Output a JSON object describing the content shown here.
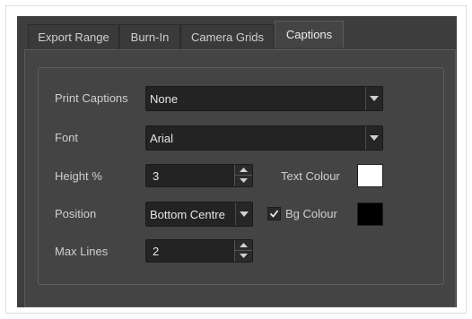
{
  "tabs": [
    {
      "label": "Export Range",
      "active": false
    },
    {
      "label": "Burn-In",
      "active": false
    },
    {
      "label": "Camera Grids",
      "active": false
    },
    {
      "label": "Captions",
      "active": true
    }
  ],
  "captions": {
    "print_captions": {
      "label": "Print Captions",
      "value": "None"
    },
    "font": {
      "label": "Font",
      "value": "Arial"
    },
    "height": {
      "label": "Height %",
      "value": "3"
    },
    "text_colour": {
      "label": "Text Colour",
      "color": "#ffffff"
    },
    "position": {
      "label": "Position",
      "value": "Bottom Centre"
    },
    "bg_colour": {
      "label": "Bg Colour",
      "checked": true,
      "color": "#000000"
    },
    "max_lines": {
      "label": "Max Lines",
      "value": "2"
    }
  },
  "icons": {
    "dropdown": "triangle-down-icon",
    "spin_up": "triangle-up-icon",
    "spin_down": "triangle-down-icon",
    "check": "checkmark-icon"
  }
}
